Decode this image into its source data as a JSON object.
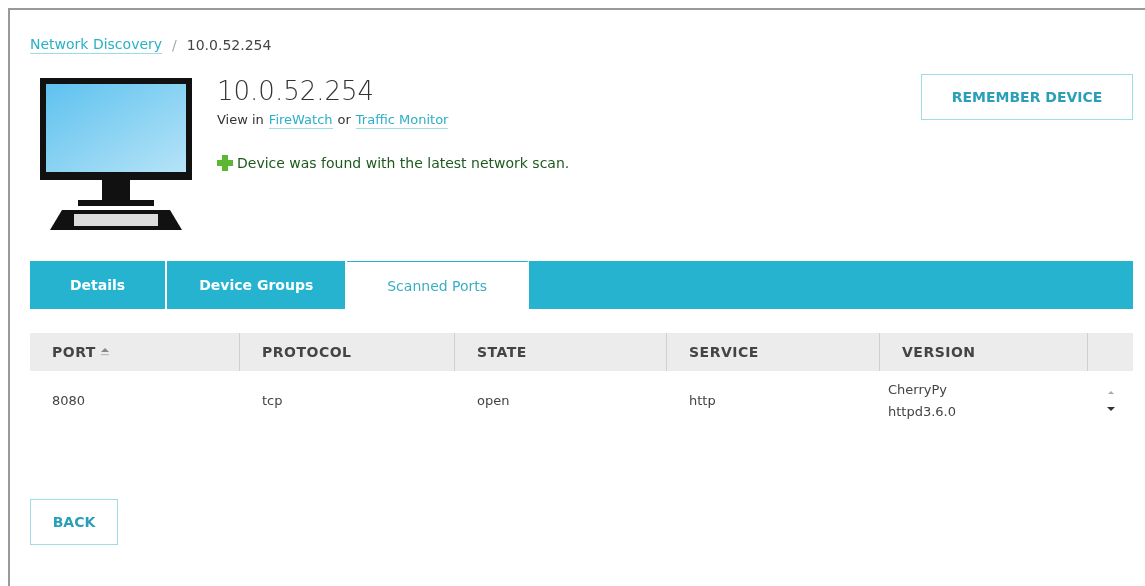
{
  "breadcrumb": [
    {
      "label": "Network Discovery",
      "kind": "link"
    },
    {
      "label": "10.0.52.254",
      "kind": "current"
    }
  ],
  "separator": "/",
  "device": {
    "title": "10.0.52.254",
    "view_in": {
      "prefix": "View in",
      "links": [
        "FireWatch",
        "Traffic Monitor"
      ],
      "joiner": "or"
    },
    "status": "Device was found with the latest network scan."
  },
  "remember_button": "REMEMBER DEVICE",
  "tabs": [
    {
      "label": "Details",
      "selected": false
    },
    {
      "label": "Device Groups",
      "selected": false
    },
    {
      "label": "Scanned Ports",
      "selected": true
    }
  ],
  "table": {
    "columns": [
      {
        "label": "PORT",
        "sorted": true
      },
      {
        "label": "PROTOCOL",
        "sorted": false
      },
      {
        "label": "STATE",
        "sorted": false
      },
      {
        "label": "SERVICE",
        "sorted": false
      },
      {
        "label": "VERSION",
        "sorted": false
      }
    ],
    "rows": [
      [
        "8080",
        "tcp",
        "open",
        "http",
        "CherryPy httpd3.6.0"
      ]
    ]
  },
  "back_button": "BACK"
}
